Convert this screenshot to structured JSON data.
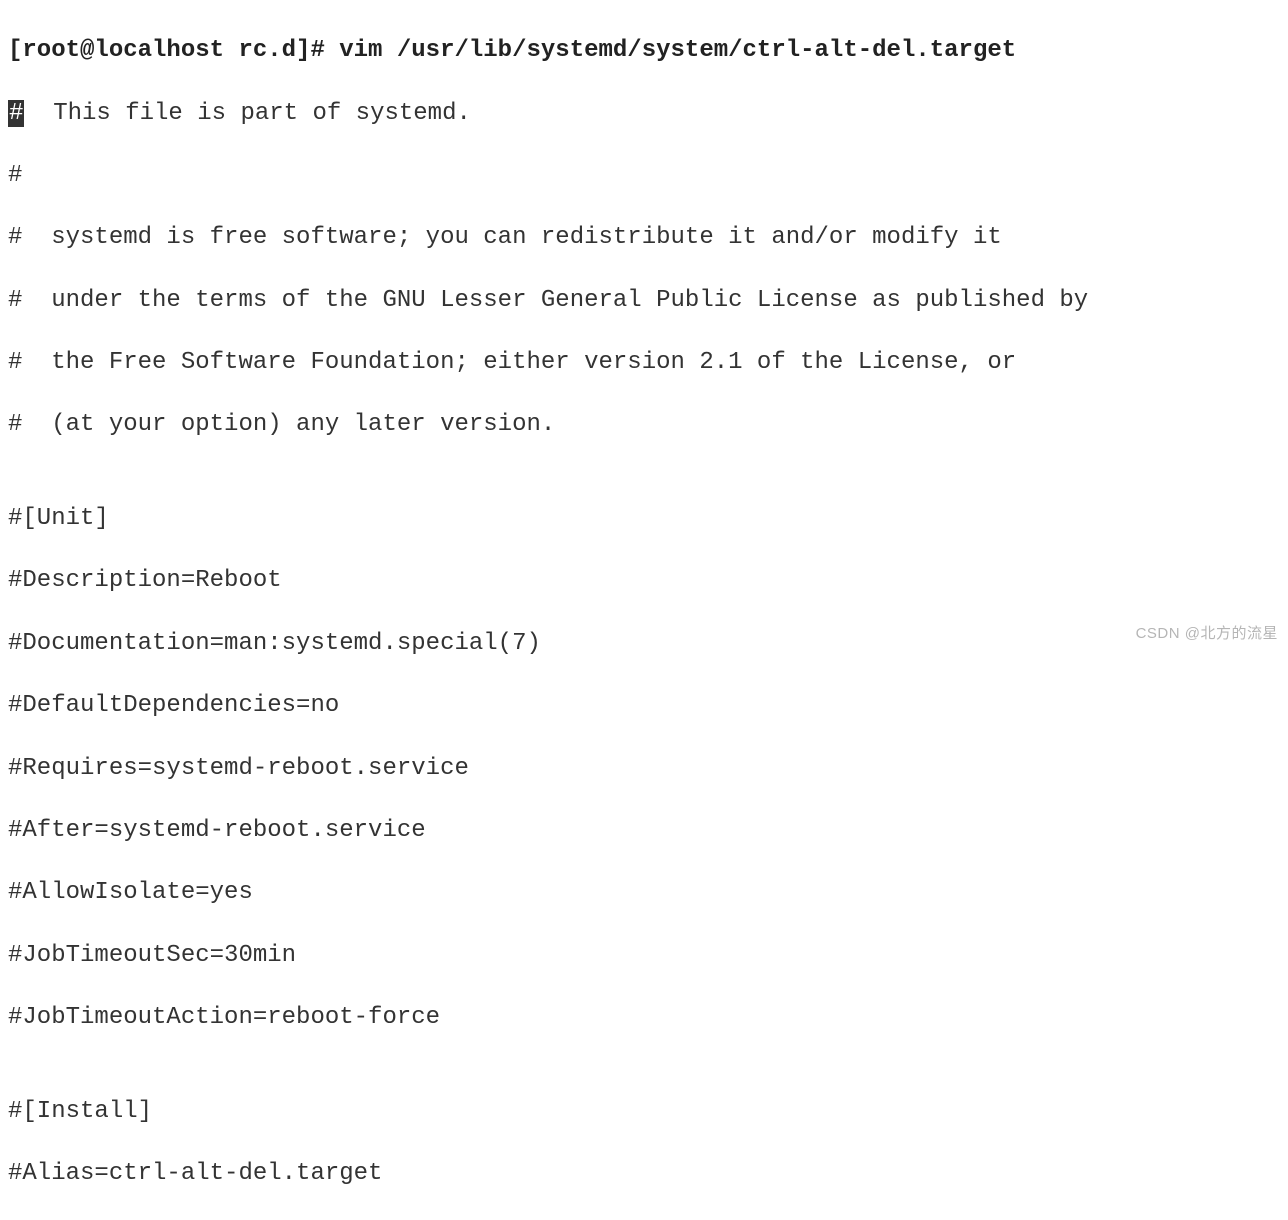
{
  "terminal": {
    "prompt": "[root@localhost rc.d]# vim /usr/lib/systemd/system/ctrl-alt-del.target",
    "cursor_char": "#",
    "line1_rest": "  This file is part of systemd.",
    "line2": "#",
    "line3": "#  systemd is free software; you can redistribute it and/or modify it",
    "line4": "#  under the terms of the GNU Lesser General Public License as published by",
    "line5": "#  the Free Software Foundation; either version 2.1 of the License, or",
    "line6": "#  (at your option) any later version.",
    "line7": "",
    "line8": "#[Unit]",
    "line9": "#Description=Reboot",
    "line10": "#Documentation=man:systemd.special(7)",
    "line11": "#DefaultDependencies=no",
    "line12": "#Requires=systemd-reboot.service",
    "line13": "#After=systemd-reboot.service",
    "line14": "#AllowIsolate=yes",
    "line15": "#JobTimeoutSec=30min",
    "line16": "#JobTimeoutAction=reboot-force",
    "line17": "",
    "line18": "#[Install]",
    "line19": "#Alias=ctrl-alt-del.target"
  },
  "watermark": "CSDN @北方的流星"
}
